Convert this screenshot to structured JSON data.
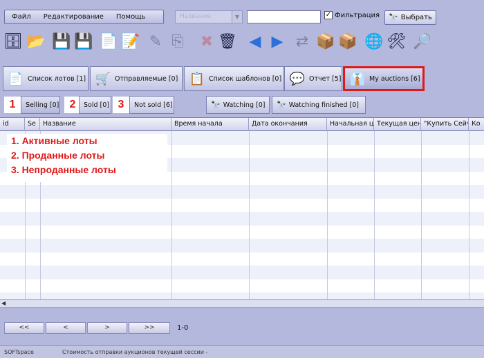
{
  "menu": {
    "file": "Файл",
    "edit": "Редактирование",
    "help": "Помощь"
  },
  "search": {
    "combo_placeholder": "Название",
    "query": "",
    "filter_label": "Фильтрация",
    "filter_checked": "✓",
    "choose_label": "Выбрать"
  },
  "toolbar": [
    {
      "icon": "database-icon",
      "glyph": "🗄"
    },
    {
      "icon": "folder-open-icon",
      "glyph": "📂"
    },
    {
      "icon": "save-icon",
      "glyph": "💾"
    },
    {
      "icon": "save-as-icon",
      "glyph": "💾"
    },
    {
      "icon": "new-page-icon",
      "glyph": "📄"
    },
    {
      "icon": "document-icon",
      "glyph": "📝"
    },
    {
      "icon": "edit-icon",
      "glyph": "✎"
    },
    {
      "icon": "copy-icon",
      "glyph": "⎘"
    },
    {
      "icon": "delete-icon",
      "glyph": "✖"
    },
    {
      "icon": "trash-icon",
      "glyph": "🗑"
    },
    {
      "icon": "arrow-left-icon",
      "glyph": "◀"
    },
    {
      "icon": "arrow-right-icon",
      "glyph": "▶"
    },
    {
      "icon": "move-icon",
      "glyph": "⇄"
    },
    {
      "icon": "package-down-icon",
      "glyph": "📦"
    },
    {
      "icon": "package-up-icon",
      "glyph": "📦"
    },
    {
      "icon": "globe-icon",
      "glyph": "🌐"
    },
    {
      "icon": "tools-icon",
      "glyph": "🛠"
    },
    {
      "icon": "search-key-icon",
      "glyph": "🔎"
    }
  ],
  "tabs": [
    {
      "label": "Список лотов [1]",
      "icon": "document-list-icon",
      "glyph": "📄"
    },
    {
      "label": "Отправляемые [0]",
      "icon": "cart-icon",
      "glyph": "🛒"
    },
    {
      "label": "Список шаблонов [0]",
      "icon": "template-icon",
      "glyph": "📋"
    },
    {
      "label": "Отчет [5]",
      "icon": "report-icon",
      "glyph": "💬"
    },
    {
      "label": "My auctions [6]",
      "icon": "user-suit-icon",
      "glyph": "👔"
    }
  ],
  "subtabs": {
    "selling": "Selling [0]",
    "sold": "Sold [0]",
    "not_sold": "Not sold [6]",
    "watching": "Watching [0]",
    "watching_finished": "Watching finished [0]"
  },
  "markers": {
    "m1": "1",
    "m2": "2",
    "m3": "3"
  },
  "columns": [
    "id",
    "Se",
    "Название",
    "Время начала",
    "Дата окончания",
    "Начальная ц",
    "Текущая цен",
    "\"Купить Сейч",
    "Ко"
  ],
  "annotation": {
    "line1": "1. Активные лоты",
    "line2": "2. Проданные лоты",
    "line3": "3. Непроданные лоты"
  },
  "pager": {
    "first": "<<",
    "prev": "<",
    "next": ">",
    "last": ">>",
    "count": "1-0"
  },
  "status": {
    "left": "SOFTspace",
    "msg": "Стоимость отправки аукционов текущей сессии - "
  },
  "colors": {
    "accent_red": "#e01818",
    "bg": "#b4b8dc"
  }
}
